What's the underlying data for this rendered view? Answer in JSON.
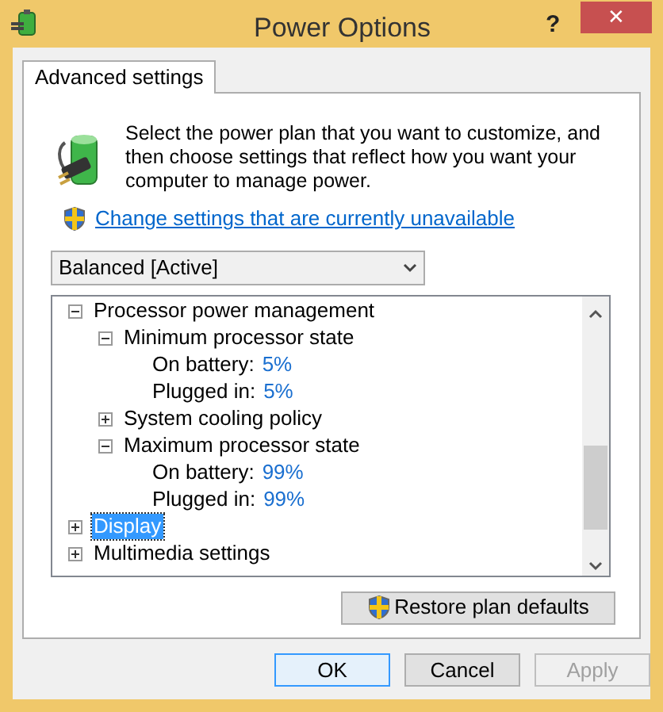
{
  "window": {
    "title": "Power Options",
    "help": "?",
    "close": "✕"
  },
  "tabs": [
    {
      "label": "Advanced settings",
      "selected": true
    }
  ],
  "description": "Select the power plan that you want to customize, and then choose settings that reflect how you want your computer to manage power.",
  "change_link": "Change settings that are currently unavailable",
  "plan_dropdown": {
    "value": "Balanced [Active]"
  },
  "tree": [
    {
      "label": "Processor power management",
      "expanded": true,
      "selected": false,
      "children": [
        {
          "label": "Minimum processor state",
          "expanded": true,
          "selected": false,
          "children": [
            {
              "label": "On battery:",
              "value": "5%"
            },
            {
              "label": "Plugged in:",
              "value": "5%"
            }
          ]
        },
        {
          "label": "System cooling policy",
          "expanded": false,
          "selected": false
        },
        {
          "label": "Maximum processor state",
          "expanded": true,
          "selected": false,
          "children": [
            {
              "label": "On battery:",
              "value": "99%"
            },
            {
              "label": "Plugged in:",
              "value": "99%"
            }
          ]
        }
      ]
    },
    {
      "label": "Display",
      "expanded": false,
      "selected": true
    },
    {
      "label": "Multimedia settings",
      "expanded": false,
      "selected": false
    }
  ],
  "restore_button": "Restore plan defaults",
  "buttons": [
    {
      "label": "OK",
      "disabled": false,
      "default": true
    },
    {
      "label": "Cancel",
      "disabled": false,
      "default": false
    },
    {
      "label": "Apply",
      "disabled": true,
      "default": false
    }
  ]
}
